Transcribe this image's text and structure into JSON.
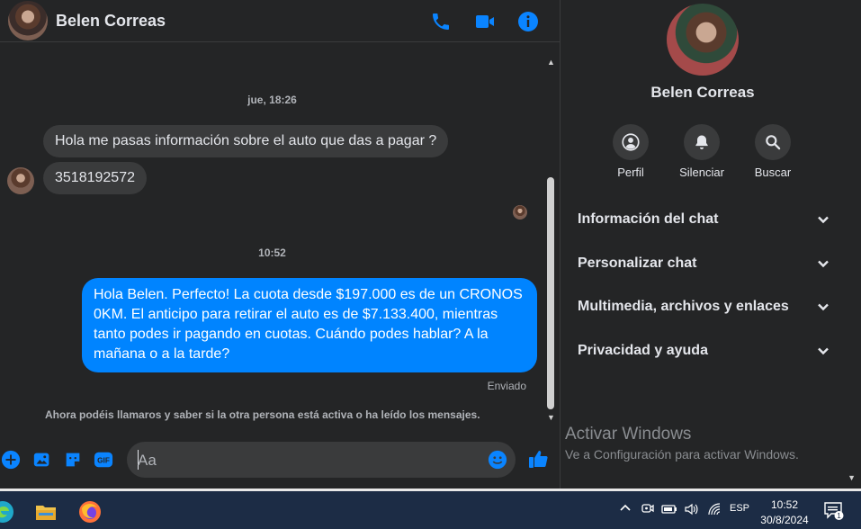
{
  "header": {
    "name": "Belen Correas"
  },
  "messages": {
    "timestamp1": "jue, 18:26",
    "incoming1": "Hola me pasas información sobre el auto que das a pagar ?",
    "incoming2": "3518192572",
    "timestamp2": "10:52",
    "outgoing1": "Hola Belen. Perfecto! La cuota desde $197.000 es de un CRONOS 0KM. El anticipo para retirar el auto es de $7.133.400, mientras tanto podes ir pagando en cuotas. Cuándo podes hablar? A la mañana o a la tarde?",
    "status": "Enviado",
    "notice": "Ahora podéis llamaros y saber si la otra persona está activa o ha leído los mensajes."
  },
  "composer": {
    "placeholder": "Aa"
  },
  "info": {
    "name": "Belen Correas",
    "actions": [
      {
        "label": "Perfil",
        "icon": "profile-icon"
      },
      {
        "label": "Silenciar",
        "icon": "bell-icon"
      },
      {
        "label": "Buscar",
        "icon": "search-icon"
      }
    ],
    "sections": [
      {
        "label": "Información del chat"
      },
      {
        "label": "Personalizar chat"
      },
      {
        "label": "Multimedia, archivos y enlaces"
      },
      {
        "label": "Privacidad y ayuda"
      }
    ]
  },
  "watermark": {
    "title": "Activar Windows",
    "subtitle": "Ve a Configuración para activar Windows."
  },
  "taskbar": {
    "language": "ESP",
    "time": "10:52",
    "date": "30/8/2024",
    "notifications": "1"
  },
  "colors": {
    "accent": "#0084ff",
    "background": "#242526",
    "bubble_in": "#3a3b3c",
    "taskbar": "#1c2c45"
  }
}
